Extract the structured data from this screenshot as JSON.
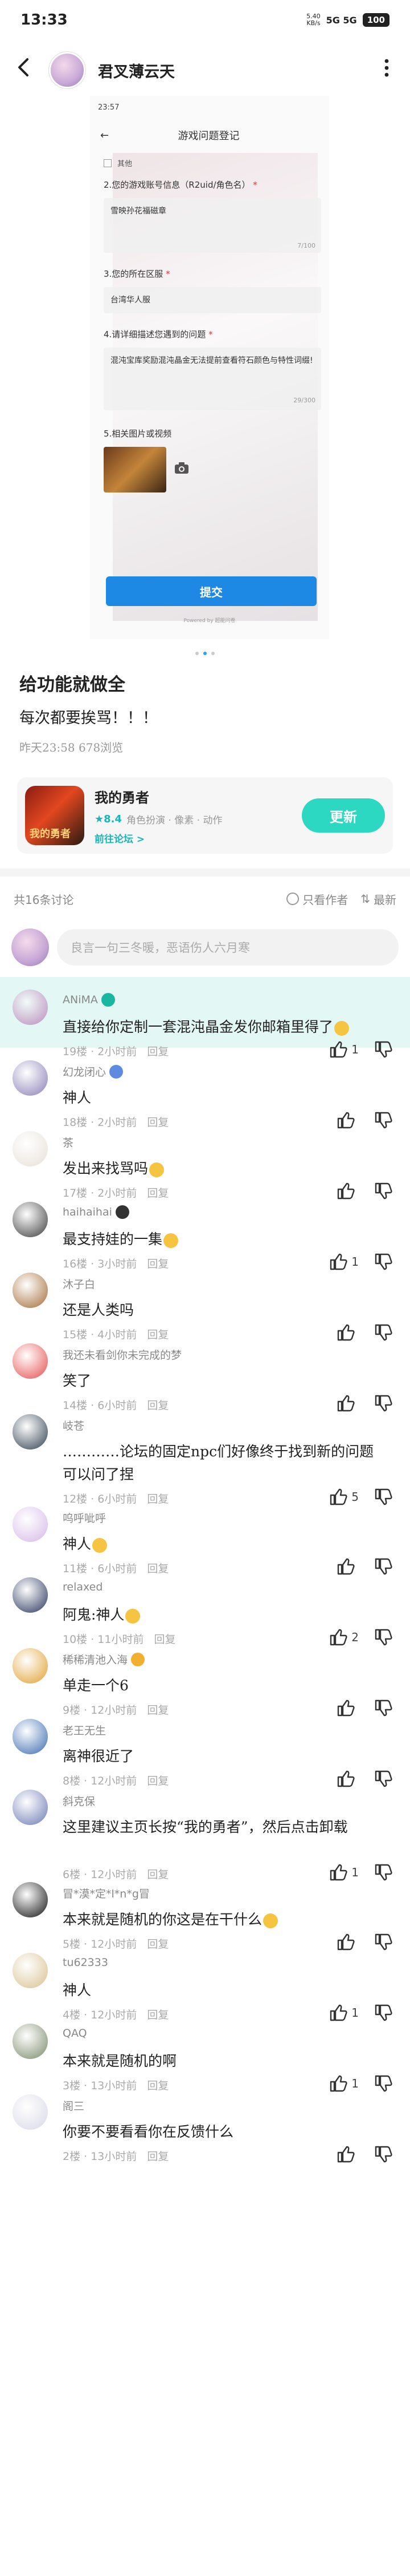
{
  "status": {
    "time": "13:33",
    "speed_value": "5.40",
    "speed_unit": "KB/s",
    "signal": "5G 5G",
    "battery": "100"
  },
  "header": {
    "title": "君叉薄云天"
  },
  "image": {
    "status_time": "23:57",
    "page_title": "游戏问题登记",
    "checkbox_other": "其他",
    "q2": "2.您的游戏账号信息（R2uid/角色名）",
    "q2_answer": "雪映孙花福磁章",
    "q2_count": "7/100",
    "q3": "3.您的所在区服",
    "q3_answer": "台湾华人服",
    "q4": "4.请详细描述您遇到的问题",
    "q4_answer": "混沌宝库奖励混沌晶金无法提前查看符石颜色与特性词缀!",
    "q4_count": "29/300",
    "q5": "5.相关图片或视频",
    "submit": "提交",
    "footer": "Powered by 超能问卷"
  },
  "post": {
    "title": "给功能就做全",
    "text": "每次都要挨骂！！！",
    "meta": "昨天23:58  678浏览"
  },
  "game": {
    "name": "我的勇者",
    "score": "8.4",
    "tags": "角色扮演 · 像素 · 动作",
    "forum": "前往论坛 >",
    "button": "更新"
  },
  "discussion": {
    "count": "共16条讨论",
    "only_author": "只看作者",
    "sort": "最新"
  },
  "reply": {
    "placeholder": "良言一句三冬暖，恶语伤人六月寒"
  },
  "comments": [
    {
      "name": "ANiMA",
      "text": "直接给你定制一套混沌晶金发你邮箱里得了",
      "meta": "19楼 · 2小时前",
      "reply": "回复",
      "likes": "1"
    },
    {
      "name": "幻龙闭心",
      "text": "神人",
      "meta": "18楼 · 2小时前",
      "reply": "回复",
      "likes": ""
    },
    {
      "name": "茶",
      "text": "发出来找骂吗",
      "meta": "17楼 · 2小时前",
      "reply": "回复",
      "likes": ""
    },
    {
      "name": "haihaihai",
      "text": "最支持娃的一集",
      "meta": "16楼 · 3小时前",
      "reply": "回复",
      "likes": "1"
    },
    {
      "name": "沐子白",
      "text": "还是人类吗",
      "meta": "15楼 · 4小时前",
      "reply": "回复",
      "likes": ""
    },
    {
      "name": "我还未看剑你未完成的梦",
      "text": "笑了",
      "meta": "14楼 · 6小时前",
      "reply": "回复",
      "likes": ""
    },
    {
      "name": "岐苍",
      "text": "…………论坛的固定npc们好像终于找到新的问题可以问了捏",
      "meta": "12楼 · 6小时前",
      "reply": "回复",
      "likes": "5"
    },
    {
      "name": "呜呼呲呼",
      "text": "神人",
      "meta": "11楼 · 6小时前",
      "reply": "回复",
      "likes": ""
    },
    {
      "name": "relaxed",
      "text": "阿鬼:神人",
      "meta": "10楼 · 11小时前",
      "reply": "回复",
      "likes": "2"
    },
    {
      "name": "稀稀清池入海",
      "text": "单走一个6",
      "meta": "9楼 · 12小时前",
      "reply": "回复",
      "likes": ""
    },
    {
      "name": "老王无生",
      "text": "离神很近了",
      "meta": "8楼 · 12小时前",
      "reply": "回复",
      "likes": ""
    },
    {
      "name": "斜克保",
      "text": "这里建议主页长按“我的勇者”，然后点击卸载",
      "meta": "6楼 · 12小时前",
      "reply": "回复",
      "likes": "1"
    },
    {
      "name": "冒*漠*定*l*n*g冒",
      "text": "本来就是随机的你这是在干什么",
      "meta": "5楼 · 12小时前",
      "reply": "回复",
      "likes": ""
    },
    {
      "name": "tu62333",
      "text": "神人",
      "meta": "4楼 · 12小时前",
      "reply": "回复",
      "likes": "1"
    },
    {
      "name": "QAQ",
      "text": "本来就是随机的啊",
      "meta": "3楼 · 13小时前",
      "reply": "回复",
      "likes": "1"
    },
    {
      "name": "阁三",
      "text": "你要不要看看你在反馈什么",
      "meta": "2楼 · 13小时前",
      "reply": "回复",
      "likes": ""
    }
  ]
}
